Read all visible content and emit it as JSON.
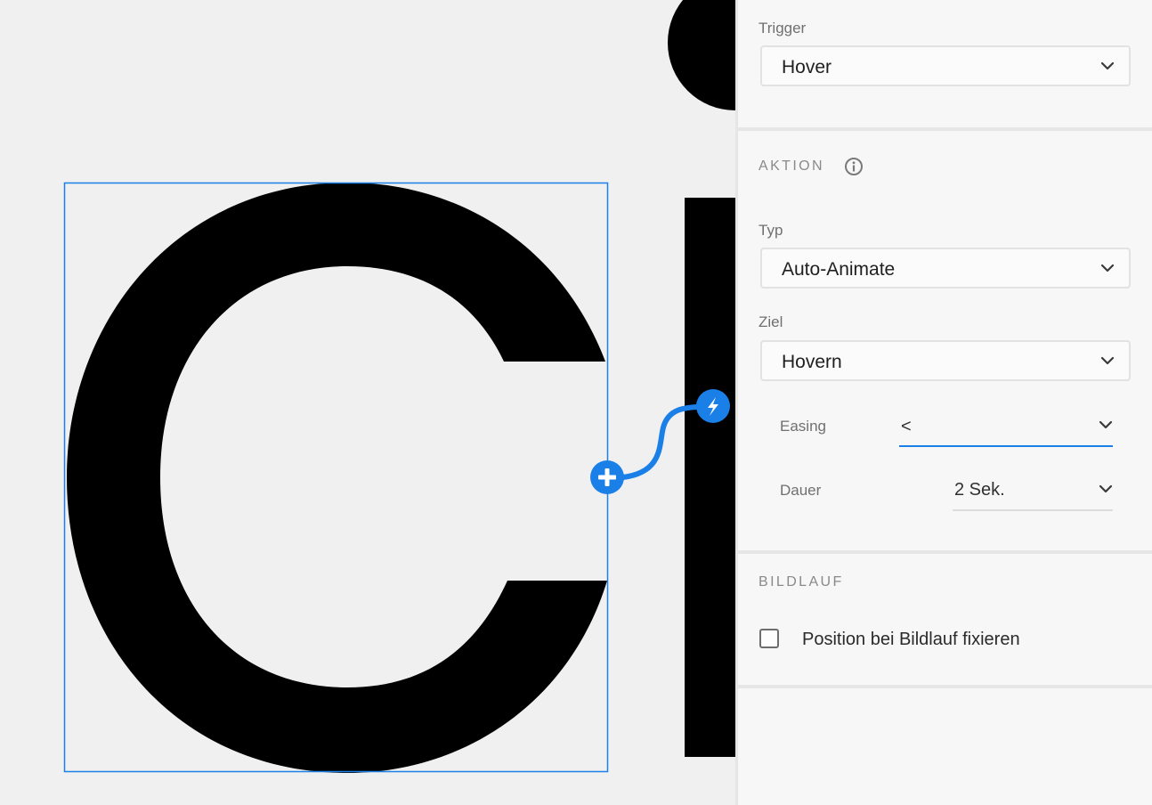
{
  "trigger": {
    "label": "Trigger",
    "value": "Hover"
  },
  "action": {
    "section_title": "AKTION",
    "type": {
      "label": "Typ",
      "value": "Auto-Animate"
    },
    "target": {
      "label": "Ziel",
      "value": "Hovern"
    },
    "easing": {
      "label": "Easing",
      "value": "<"
    },
    "duration": {
      "label": "Dauer",
      "value": "2 Sek."
    }
  },
  "scroll": {
    "section_title": "BILDLAUF",
    "fix_position": {
      "label": "Position bei Bildlauf fixieren",
      "checked": false
    }
  },
  "colors": {
    "accent": "#1a7fe6",
    "canvas_bg": "#f0f0f0",
    "panel_bg": "#f7f7f7",
    "glyph": "#000000"
  },
  "icons": {
    "add_connection": "plus-icon",
    "interaction_target": "lightning-icon",
    "info": "info-icon",
    "dropdown": "chevron-down-icon"
  }
}
